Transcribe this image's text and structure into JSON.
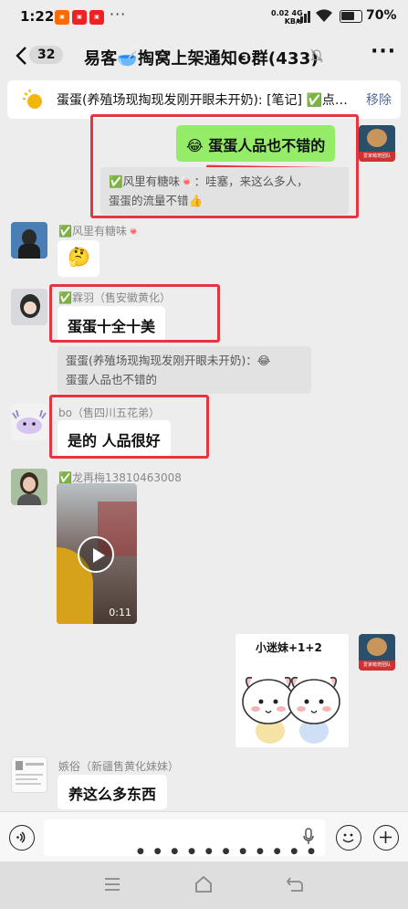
{
  "status_bar": {
    "time": "1:22",
    "net_speed_value": "0.02",
    "net_speed_unit": "KB/s",
    "network_type": "4G",
    "battery": "70%",
    "battery_level": 0.7,
    "dots": "···"
  },
  "header": {
    "unread_count": "32",
    "title": "易客🥣掏窝上架通知❸群(433)",
    "more": "···"
  },
  "pinned": {
    "text": "蛋蛋(养殖场现掏现发刚开眼未开奶): [笔记] ✅点…",
    "remove_label": "移除"
  },
  "messages": {
    "m1": {
      "text": "😂 蛋蛋人品也不错的"
    },
    "m1_quote": {
      "line1": "✅风里有糖味🍬：哇塞，来这么多人，",
      "line2": "蛋蛋的流量不错👍"
    },
    "m2": {
      "name": "✅风里有糖味🍬",
      "text": "🤔"
    },
    "m3": {
      "name": "✅霖羽（售安徽黄化）",
      "text": "蛋蛋十全十美"
    },
    "m3_quote": {
      "line1": "蛋蛋(养殖场现掏现发刚开眼未开奶)：😂",
      "line2": "蛋蛋人品也不错的"
    },
    "m4": {
      "name": "bo（售四川五花弟）",
      "text": "是的 人品很好"
    },
    "m5": {
      "name": "✅龙再梅13810463008",
      "duration": "0:11"
    },
    "m6": {
      "sticker_text": "小迷妹+1+2"
    },
    "m7": {
      "name": "嫉俗（新疆售黄化妹妹）",
      "text": "养这么多东西"
    }
  },
  "avatar_me_caption": "爱家萌宠团队",
  "input": {
    "placeholder": ""
  },
  "colors": {
    "my_bubble": "#95ec69",
    "annotation_red": "#e5353f",
    "link": "#576b95"
  }
}
